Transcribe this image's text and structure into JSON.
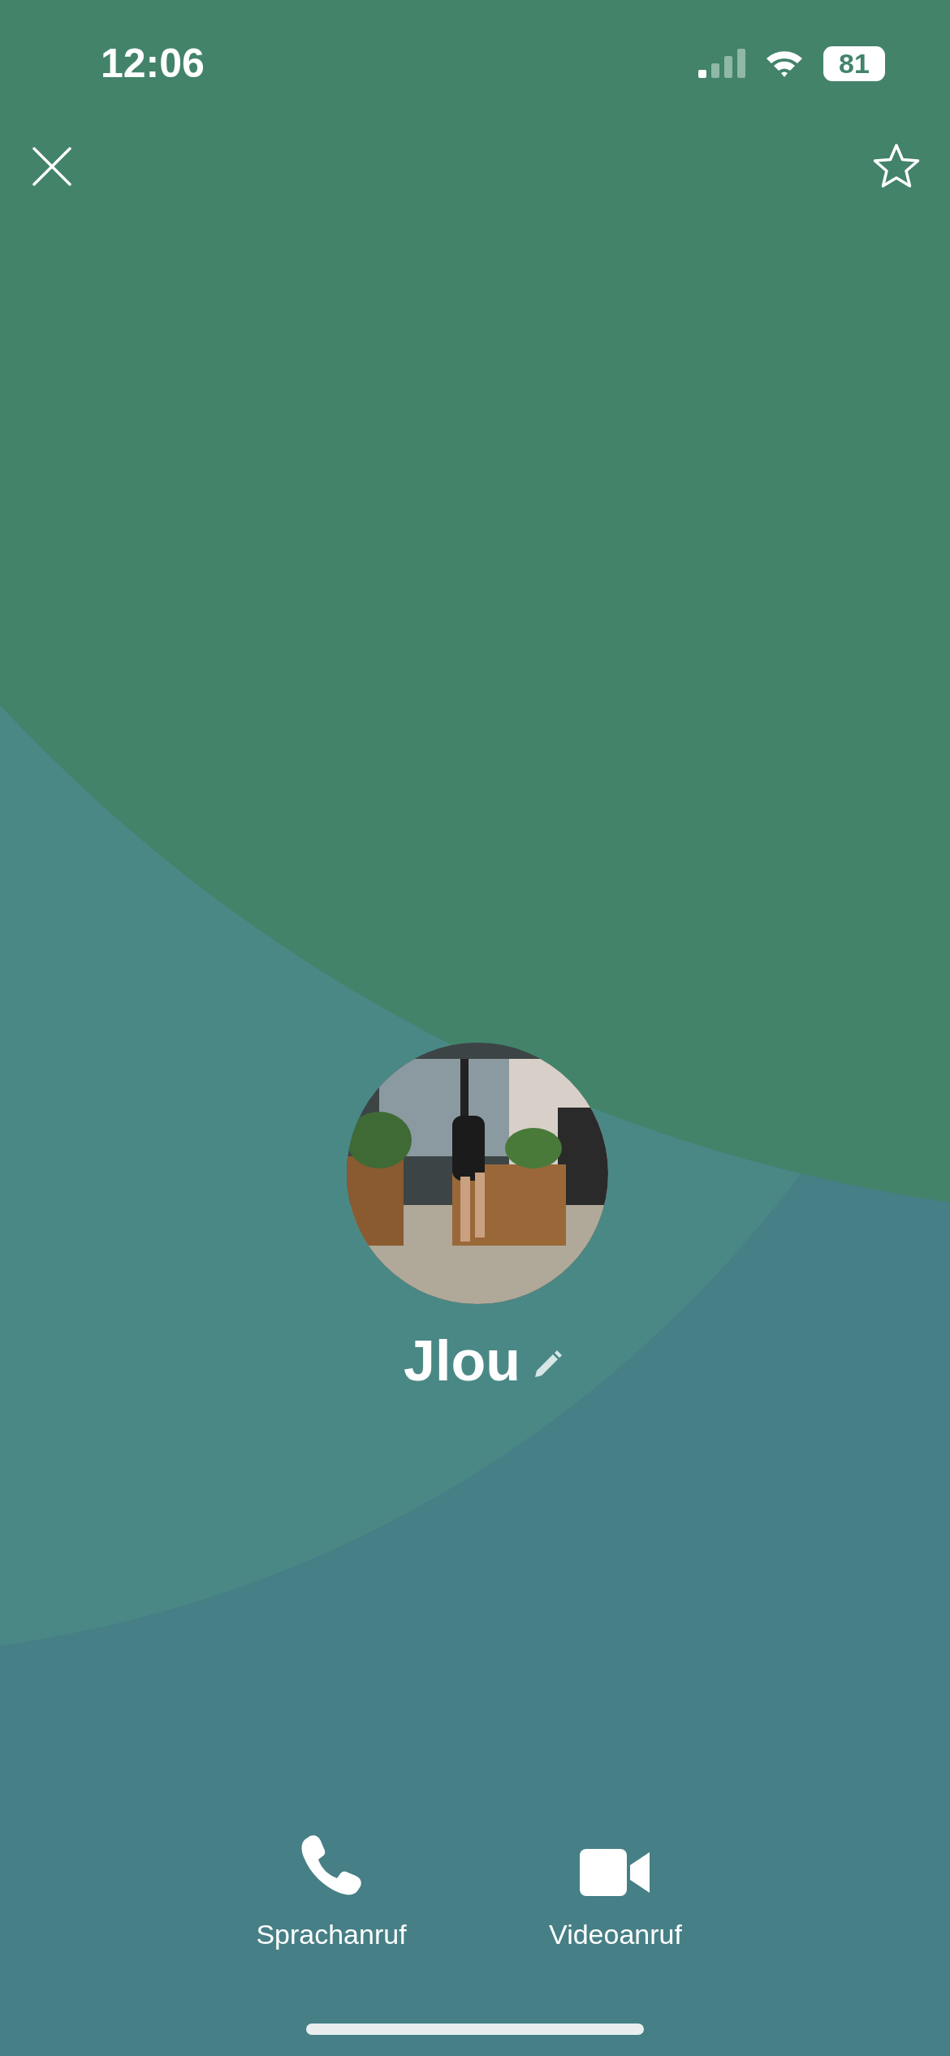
{
  "status_bar": {
    "time": "12:06",
    "battery": "81"
  },
  "contact": {
    "name": "Jlou"
  },
  "actions": [
    {
      "kind": "voice",
      "label": "Sprachanruf"
    },
    {
      "kind": "video",
      "label": "Videoanruf"
    }
  ]
}
